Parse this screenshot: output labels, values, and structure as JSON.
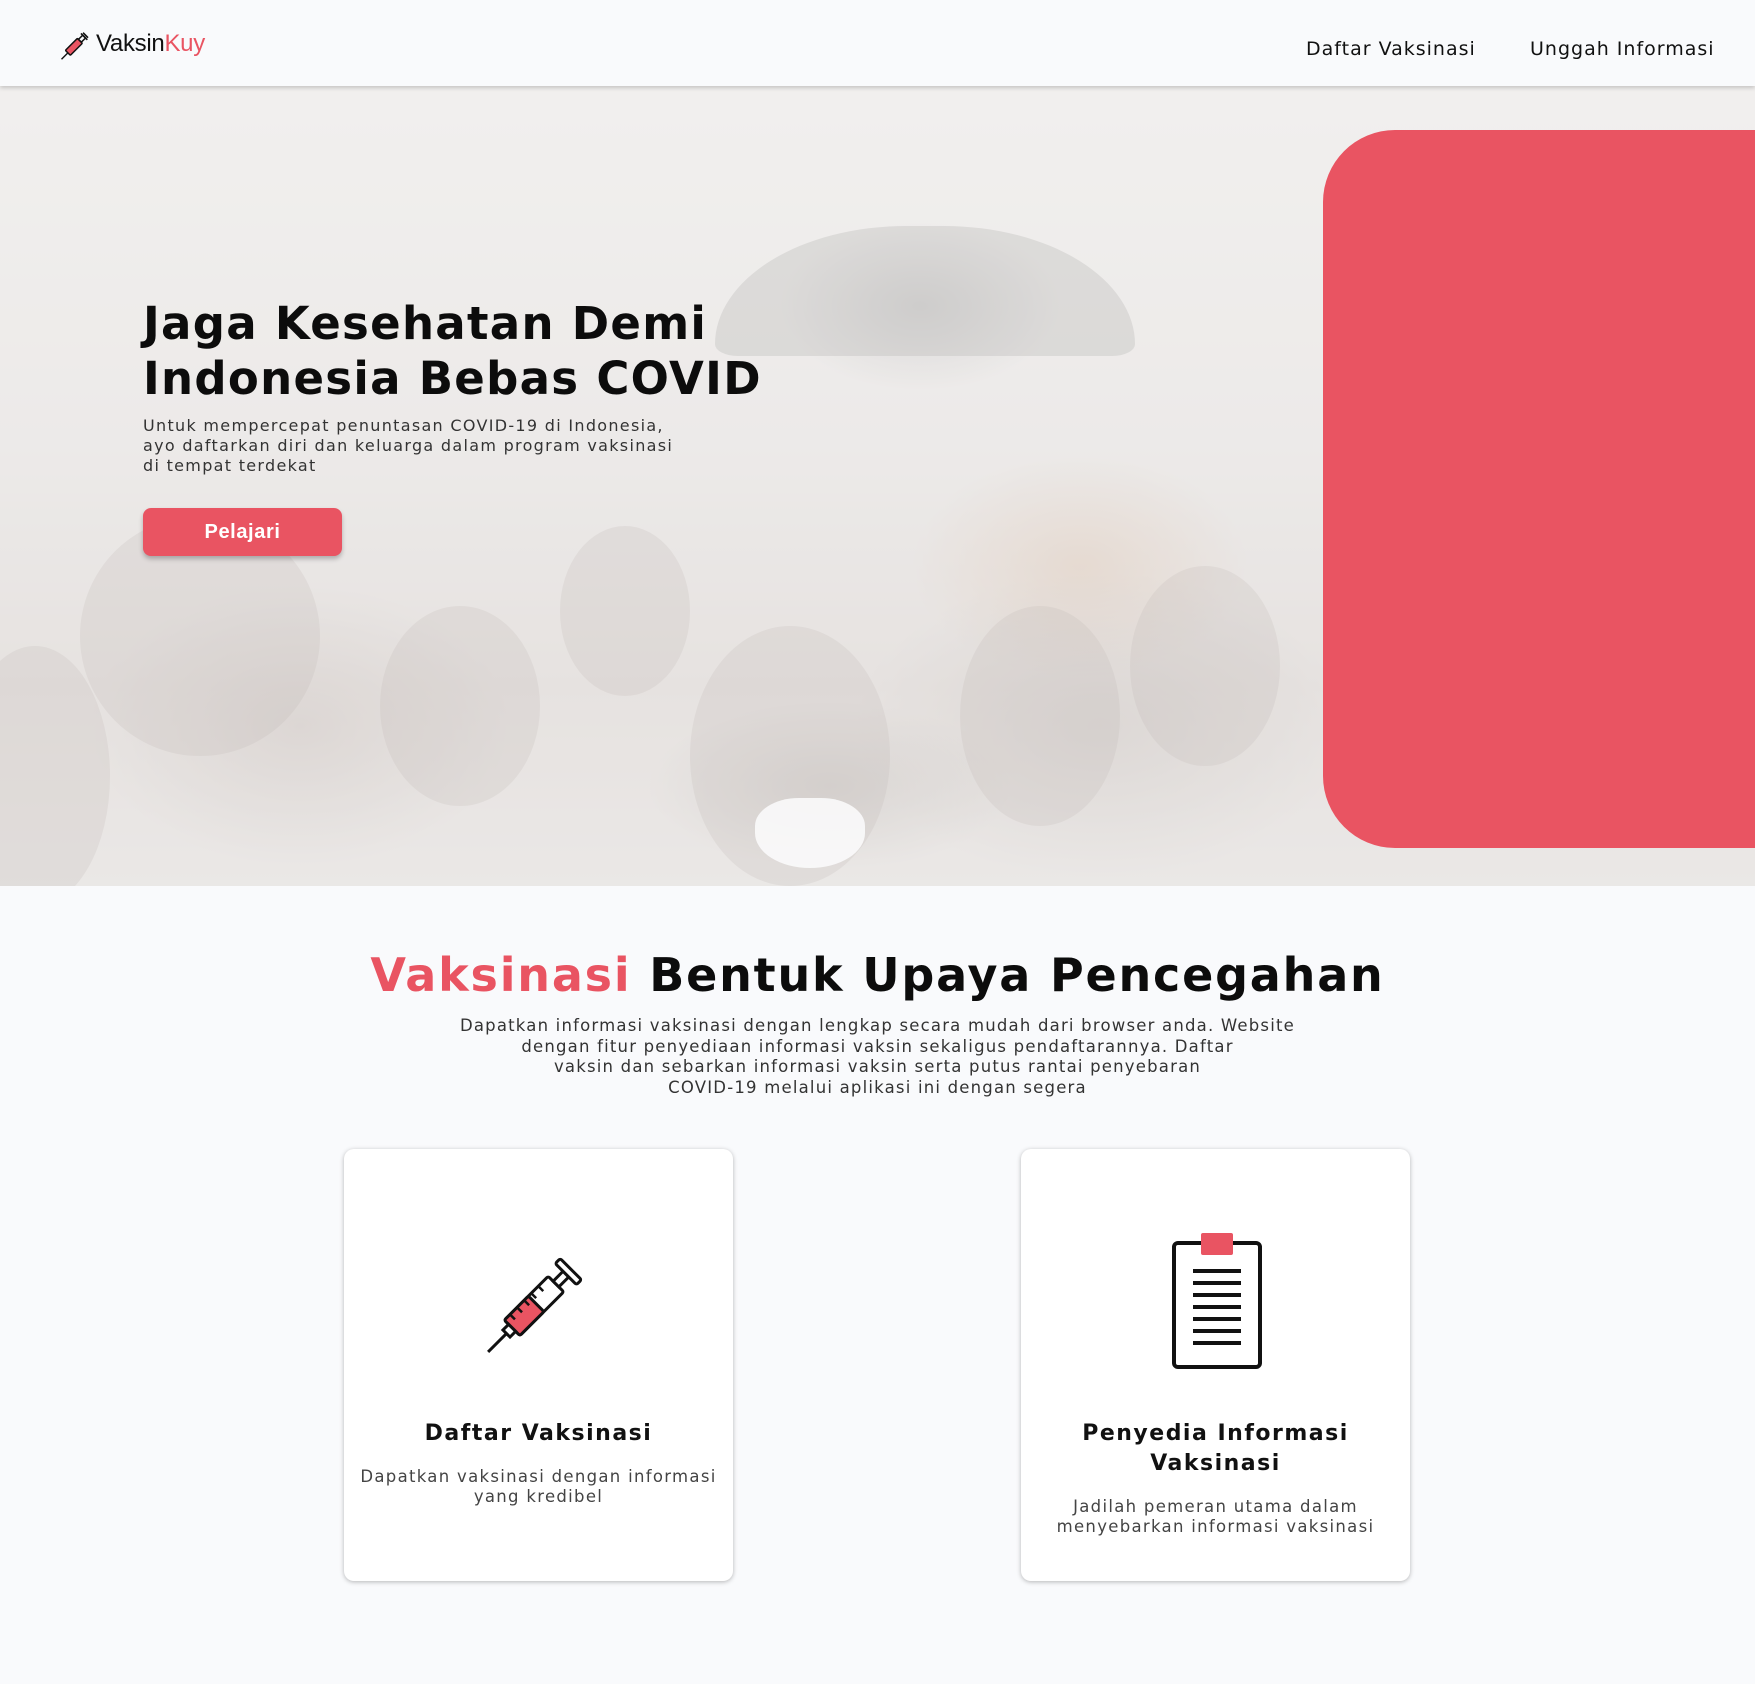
{
  "brand": {
    "name_part1": "Vaksin",
    "name_part2": "Kuy",
    "icon": "syringe-icon"
  },
  "nav": {
    "items": [
      {
        "label": "Daftar Vaksinasi"
      },
      {
        "label": "Unggah Informasi"
      }
    ]
  },
  "hero": {
    "title_line1": "Jaga Kesehatan Demi",
    "title_line2": "Indonesia Bebas COVID",
    "subtitle_line1": "Untuk mempercepat penuntasan COVID-19 di Indonesia,",
    "subtitle_line2": "ayo daftarkan diri dan keluarga dalam program vaksinasi",
    "subtitle_line3": "di tempat terdekat",
    "button_label": "Pelajari"
  },
  "section": {
    "title_accent": "Vaksinasi",
    "title_rest": "Bentuk Upaya Pencegahan",
    "desc_line1": "Dapatkan informasi vaksinasi dengan lengkap secara mudah dari browser anda. Website",
    "desc_line2": "dengan fitur penyediaan informasi vaksin sekaligus pendaftarannya. Daftar",
    "desc_line3": "vaksin dan sebarkan informasi vaksin serta putus rantai penyebaran",
    "desc_line4": "COVID-19 melalui aplikasi ini dengan segera"
  },
  "cards": [
    {
      "icon": "syringe-icon",
      "title": "Daftar Vaksinasi",
      "desc_line1": "Dapatkan vaksinasi dengan informasi",
      "desc_line2": "yang kredibel"
    },
    {
      "icon": "clipboard-icon",
      "title_line1": "Penyedia Informasi",
      "title_line2": "Vaksinasi",
      "desc_line1": "Jadilah pemeran utama dalam",
      "desc_line2": "menyebarkan informasi vaksinasi"
    }
  ],
  "colors": {
    "accent": "#e95462",
    "background": "#f9fafc",
    "text": "#111111"
  }
}
